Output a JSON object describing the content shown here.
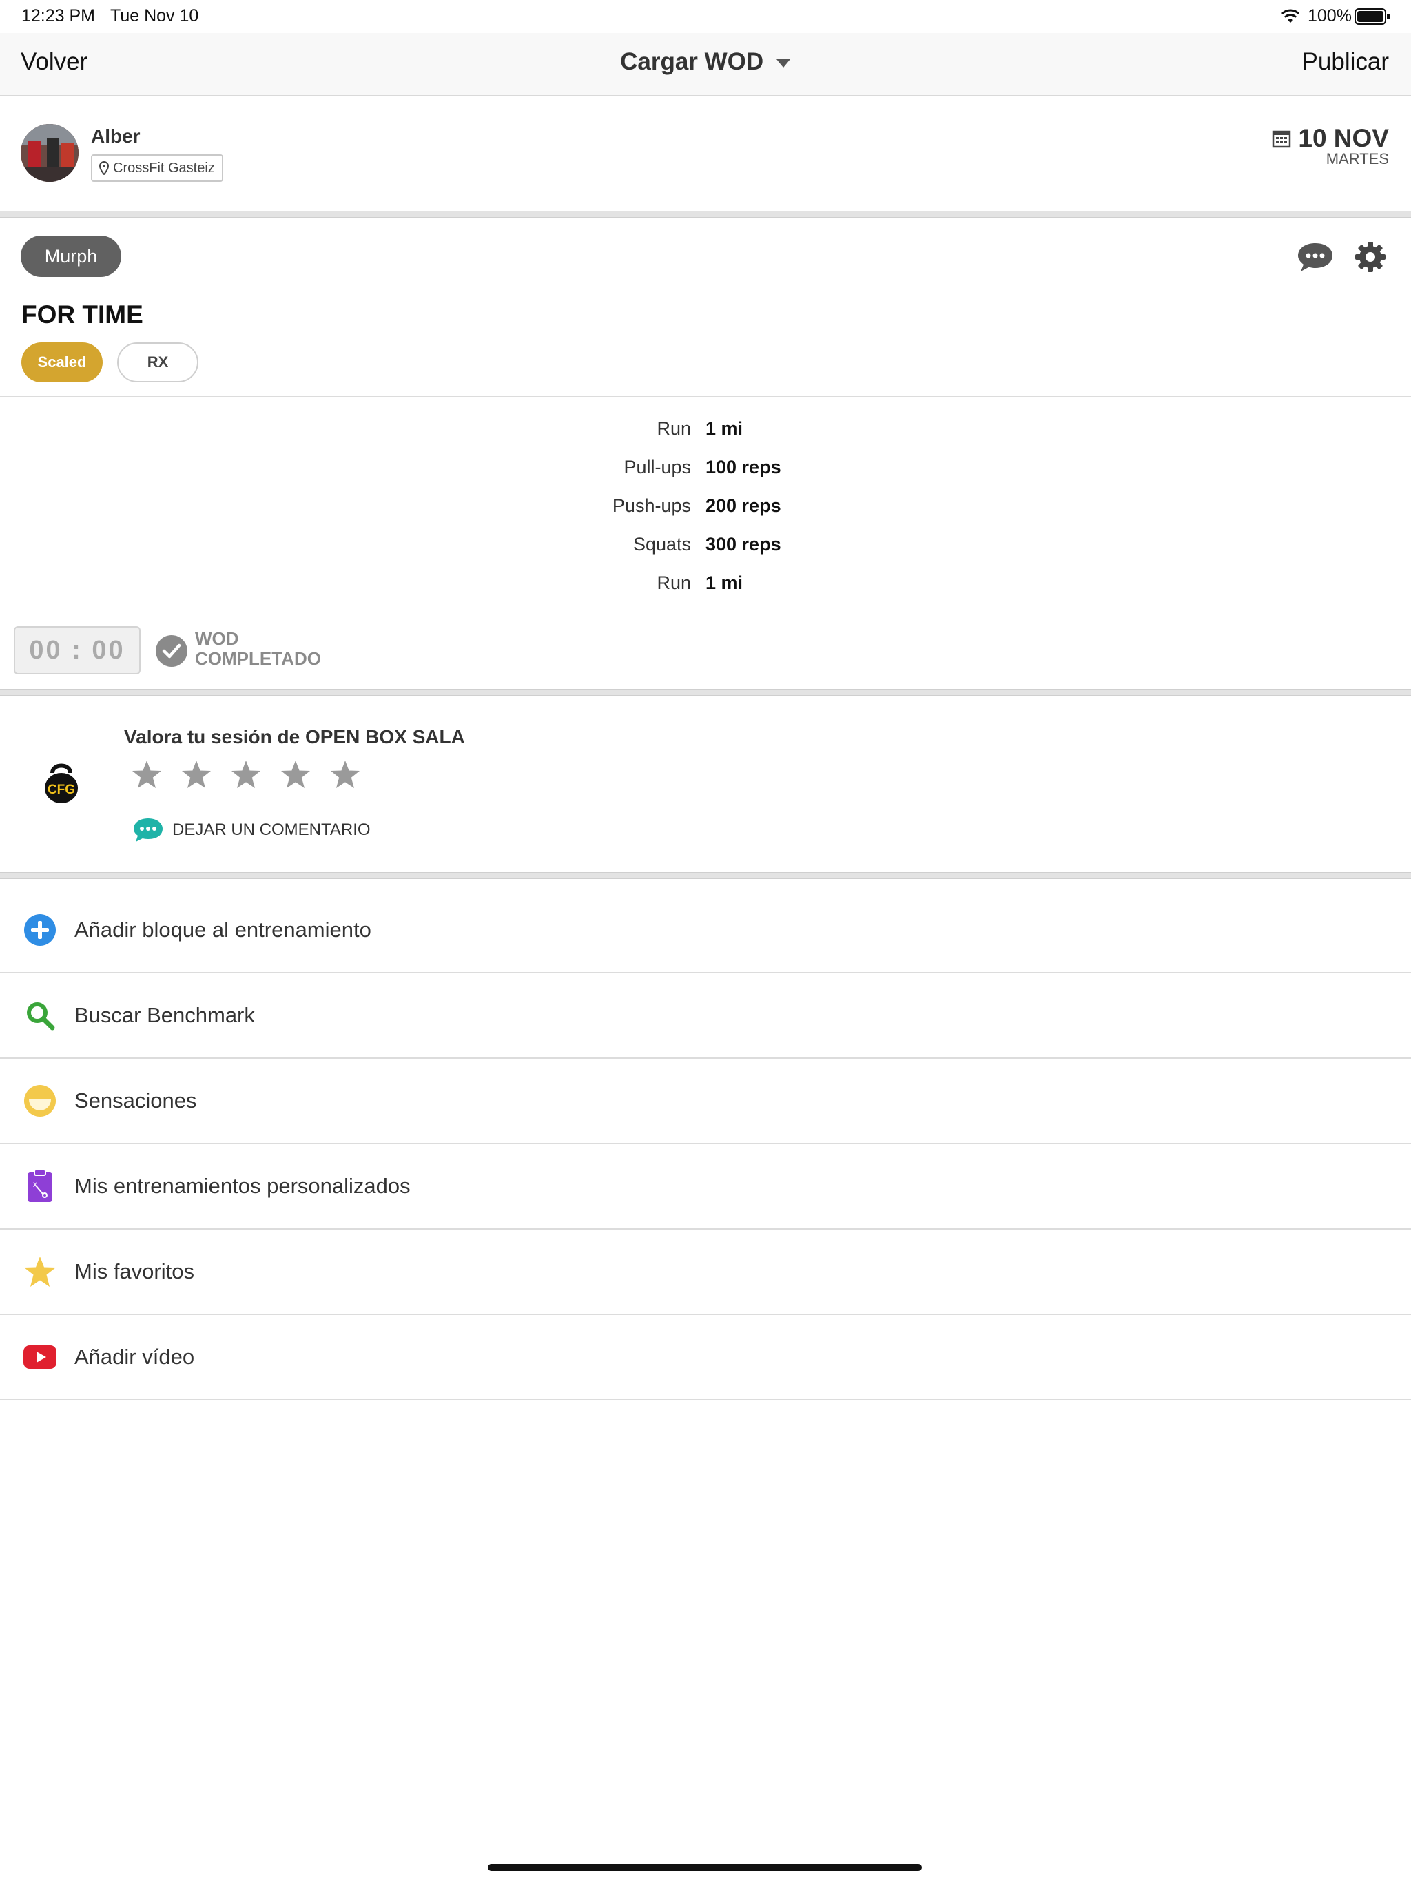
{
  "status_bar": {
    "time": "12:23 PM",
    "date": "Tue Nov 10",
    "battery": "100%"
  },
  "nav": {
    "back_label": "Volver",
    "title": "Cargar WOD",
    "publish_label": "Publicar"
  },
  "user": {
    "name": "Alber",
    "gym": "CrossFit Gasteiz"
  },
  "session_date": {
    "day": "10 NOV",
    "weekday": "MARTES"
  },
  "wod": {
    "name": "Murph",
    "type": "FOR TIME",
    "levels": {
      "selected": "Scaled",
      "other": "RX"
    },
    "exercises": [
      {
        "name": "Run",
        "value": "1 mi"
      },
      {
        "name": "Pull-ups",
        "value": "100 reps"
      },
      {
        "name": "Push-ups",
        "value": "200 reps"
      },
      {
        "name": "Squats",
        "value": "300 reps"
      },
      {
        "name": "Run",
        "value": "1 mi"
      }
    ],
    "timer": "00 : 00",
    "completed_line1": "WOD",
    "completed_line2": "COMPLETADO"
  },
  "rating": {
    "title": "Valora tu sesión de OPEN BOX SALA",
    "stars": 0,
    "max_stars": 5,
    "comment_label": "DEJAR UN COMENTARIO",
    "logo_text": "CFG"
  },
  "menu": [
    {
      "label": "Añadir bloque al entrenamiento",
      "icon": "plus-circle-icon"
    },
    {
      "label": "Buscar Benchmark",
      "icon": "search-icon"
    },
    {
      "label": "Sensaciones",
      "icon": "smiley-icon"
    },
    {
      "label": "Mis entrenamientos personalizados",
      "icon": "clipboard-icon"
    },
    {
      "label": "Mis favoritos",
      "icon": "star-icon"
    },
    {
      "label": "Añadir vídeo",
      "icon": "youtube-icon"
    }
  ],
  "colors": {
    "scaled": "#d4a52f",
    "plus": "#2f8de4",
    "search": "#3aa53a",
    "smiley": "#f3c94b",
    "clipboard": "#8e3fd6",
    "star": "#f3c94b",
    "youtube": "#e0202f",
    "comment": "#1fb3a8"
  }
}
